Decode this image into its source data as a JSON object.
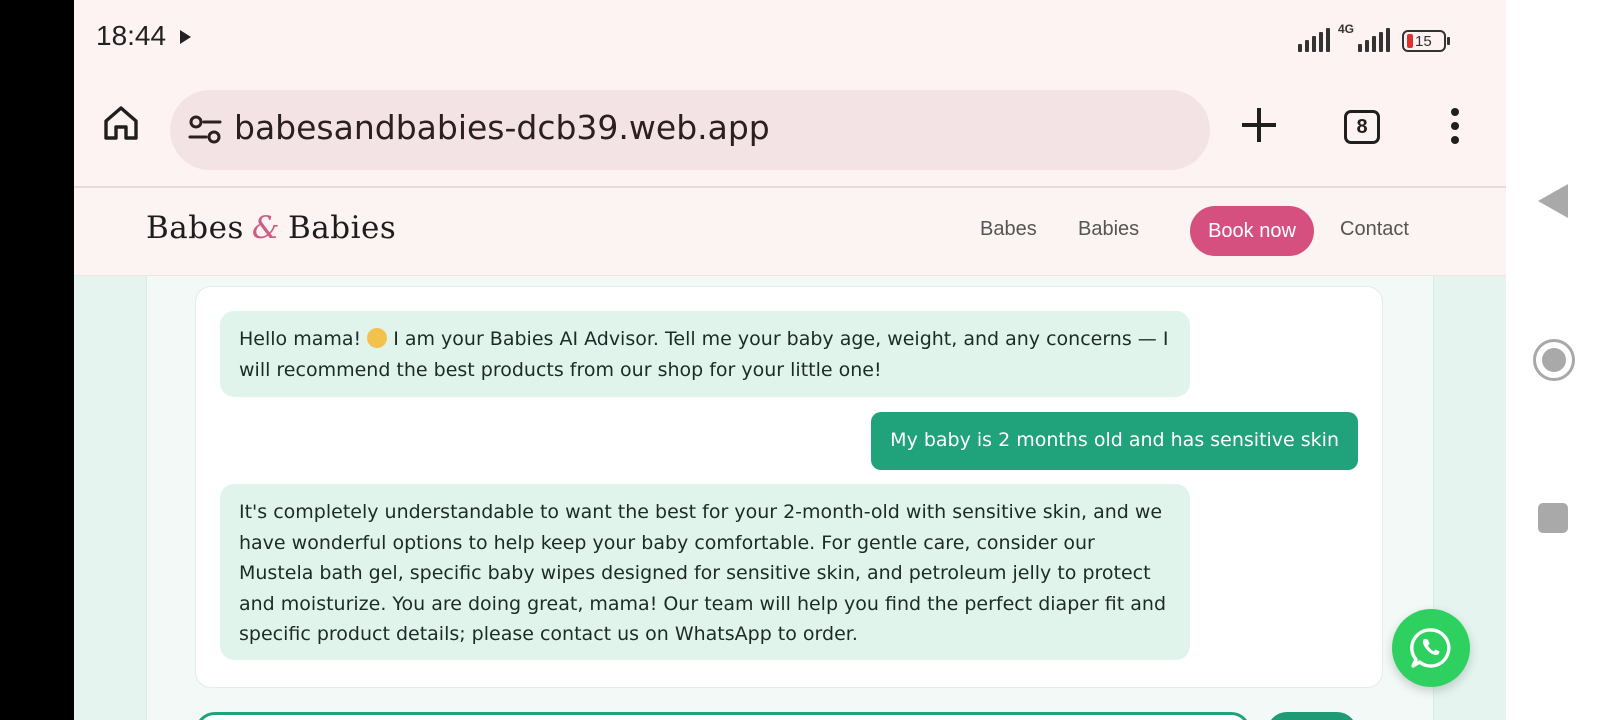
{
  "status_bar": {
    "time": "18:44",
    "network_label": "4G",
    "battery_level": "15",
    "icons": [
      "play-icon",
      "signal-icon",
      "signal-4g-icon",
      "battery-icon"
    ]
  },
  "browser": {
    "url": "babesandbabies-dcb39.web.app",
    "tab_count": "8",
    "icons": [
      "home-icon",
      "tune-icon",
      "plus-icon",
      "tabs-icon",
      "more-vert-icon"
    ]
  },
  "site": {
    "logo_left": "Babes",
    "logo_amp": "&",
    "logo_right": "Babies",
    "nav": {
      "babes": "Babes",
      "babies": "Babies",
      "book_now": "Book now",
      "contact": "Contact"
    }
  },
  "chat": {
    "messages": [
      {
        "role": "bot",
        "text_before": "Hello mama! ",
        "emoji": "baby-emoji",
        "text_after": " I am your Babies AI Advisor. Tell me your baby age, weight, and any concerns — I will recommend the best products from our shop for your little one!"
      },
      {
        "role": "user",
        "text": "My baby is 2 months old and has sensitive skin"
      },
      {
        "role": "bot",
        "text": "It's completely understandable to want the best for your 2-month-old with sensitive skin, and we have wonderful options to help keep your baby comfortable. For gentle care, consider our Mustela bath gel, specific baby wipes designed for sensitive skin, and petroleum jelly to protect and moisturize. You are doing great, mama! Our team will help you find the perfect diaper fit and specific product details; please contact us on WhatsApp to order."
      }
    ]
  },
  "colors": {
    "brand_pink": "#d6507f",
    "user_bubble": "#20a27a",
    "bot_bubble": "#e0f4ec",
    "whatsapp": "#2ed15f"
  },
  "fab": {
    "icon": "whatsapp-icon"
  },
  "system_nav": {
    "icons": [
      "back-icon",
      "home-circle-icon",
      "recents-icon"
    ]
  }
}
